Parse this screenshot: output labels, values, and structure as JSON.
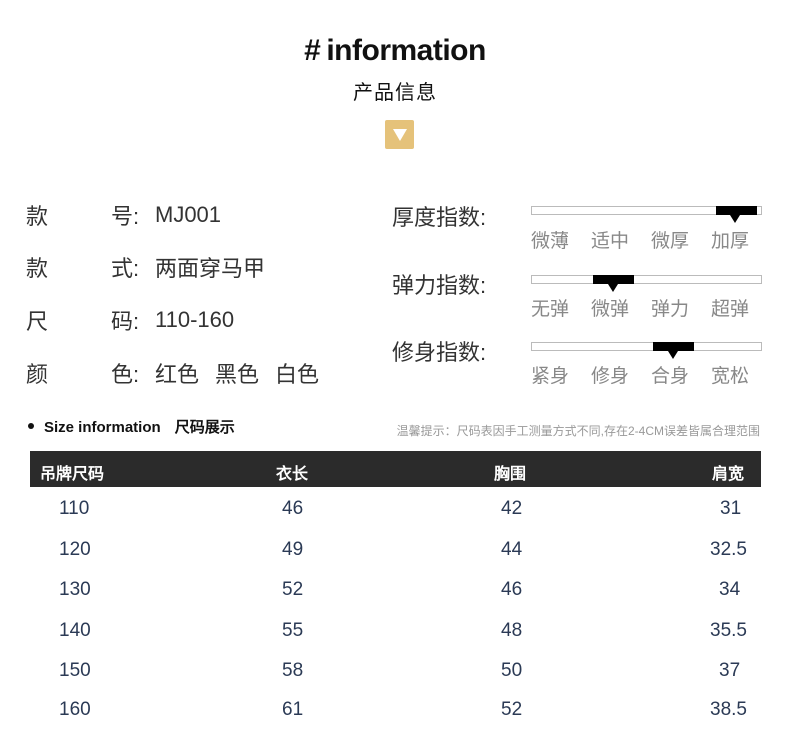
{
  "header": {
    "hash": "#",
    "title": "information",
    "subtitle": "产品信息",
    "badge_icon": "chevron-down-icon",
    "badge_color": "#e5c27a"
  },
  "specs": [
    {
      "k1": "款",
      "k2": "号:",
      "value": "MJ001"
    },
    {
      "k1": "款",
      "k2": "式:",
      "value": "两面穿马甲"
    },
    {
      "k1": "尺",
      "k2": "码:",
      "value": "110-160"
    },
    {
      "k1": "颜",
      "k2": "色:",
      "values": [
        "红色",
        "黑色",
        "白色"
      ]
    }
  ],
  "indices": [
    {
      "label": "厚度指数:",
      "options": [
        "微薄",
        "适中",
        "微厚",
        "加厚"
      ],
      "selected": "加厚",
      "selected_index": 3
    },
    {
      "label": "弹力指数:",
      "options": [
        "无弹",
        "微弹",
        "弹力",
        "超弹"
      ],
      "selected": "微弹",
      "selected_index": 1
    },
    {
      "label": "修身指数:",
      "options": [
        "紧身",
        "修身",
        "合身",
        "宽松"
      ],
      "selected": "合身",
      "selected_index": 2
    }
  ],
  "size_section": {
    "title_en": "Size information",
    "title_cn": "尺码展示",
    "tip": "温馨提示：尺码表因手工测量方式不同,存在2-4CM误差皆属合理范围"
  },
  "table": {
    "headers": [
      "吊牌尺码",
      "衣长",
      "胸围",
      "肩宽"
    ],
    "rows": [
      [
        "110",
        "46",
        "42",
        "31"
      ],
      [
        "120",
        "49",
        "44",
        "32.5"
      ],
      [
        "130",
        "52",
        "46",
        "34"
      ],
      [
        "140",
        "55",
        "48",
        "35.5"
      ],
      [
        "150",
        "58",
        "50",
        "37"
      ],
      [
        "160",
        "61",
        "52",
        "38.5"
      ]
    ]
  }
}
